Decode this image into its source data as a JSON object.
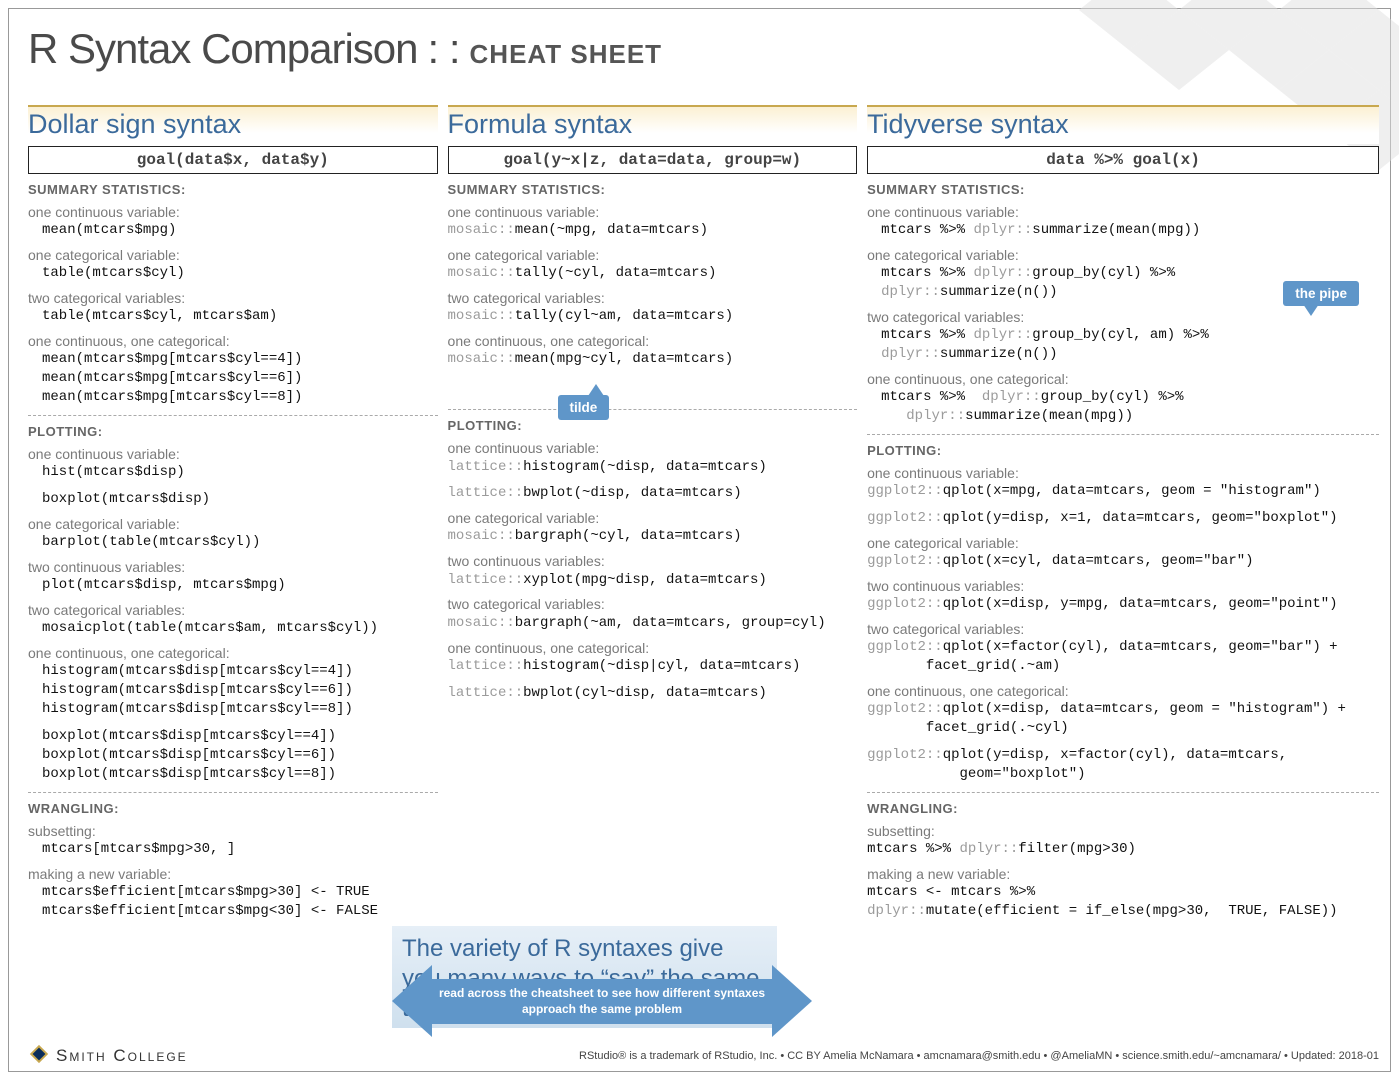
{
  "title_main": "R Syntax Comparison",
  "title_sep": ": :",
  "title_sub": "CHEAT SHEET",
  "columns": {
    "dollar": {
      "title": "Dollar sign syntax",
      "goal": "goal(data$x, data$y)",
      "summary_label": "SUMMARY STATISTICS:",
      "s1_desc": "one continuous variable:",
      "s1_code": "mean(mtcars$mpg)",
      "s2_desc": "one categorical variable:",
      "s2_code": "table(mtcars$cyl)",
      "s3_desc": "two categorical variables:",
      "s3_code": "table(mtcars$cyl, mtcars$am)",
      "s4_desc": "one continuous, one categorical:",
      "s4_code": "mean(mtcars$mpg[mtcars$cyl==4])\nmean(mtcars$mpg[mtcars$cyl==6])\nmean(mtcars$mpg[mtcars$cyl==8])",
      "plot_label": "PLOTTING:",
      "p1_desc": "one continuous variable:",
      "p1_code": "hist(mtcars$disp)",
      "p1b_code": "boxplot(mtcars$disp)",
      "p2_desc": "one categorical variable:",
      "p2_code": "barplot(table(mtcars$cyl))",
      "p3_desc": "two continuous variables:",
      "p3_code": "plot(mtcars$disp, mtcars$mpg)",
      "p4_desc": "two categorical variables:",
      "p4_code": "mosaicplot(table(mtcars$am, mtcars$cyl))",
      "p5_desc": "one continuous, one categorical:",
      "p5_code": "histogram(mtcars$disp[mtcars$cyl==4])\nhistogram(mtcars$disp[mtcars$cyl==6])\nhistogram(mtcars$disp[mtcars$cyl==8])",
      "p5b_code": "boxplot(mtcars$disp[mtcars$cyl==4])\nboxplot(mtcars$disp[mtcars$cyl==6])\nboxplot(mtcars$disp[mtcars$cyl==8])",
      "wrang_label": "WRANGLING:",
      "w1_desc": "subsetting:",
      "w1_code": "mtcars[mtcars$mpg>30, ]",
      "w2_desc": "making a new variable:",
      "w2_code": "mtcars$efficient[mtcars$mpg>30] <- TRUE\nmtcars$efficient[mtcars$mpg<30] <- FALSE"
    },
    "formula": {
      "title": "Formula syntax",
      "goal": "goal(y~x|z, data=data, group=w)",
      "summary_label": "SUMMARY STATISTICS:",
      "s1_desc": "one continuous variable:",
      "s1_pkg": "mosaic::",
      "s1_code": "mean(~mpg, data=mtcars)",
      "s2_desc": "one categorical variable:",
      "s2_pkg": "mosaic::",
      "s2_code": "tally(~cyl, data=mtcars)",
      "s3_desc": "two categorical variables:",
      "s3_pkg": "mosaic::",
      "s3_code": "tally(cyl~am, data=mtcars)",
      "s4_desc": "one continuous, one categorical:",
      "s4_pkg": "mosaic::",
      "s4_code": "mean(mpg~cyl, data=mtcars)",
      "tilde_label": "tilde",
      "plot_label": "PLOTTING:",
      "p1_desc": "one continuous variable:",
      "p1_pkg": "lattice::",
      "p1_code": "histogram(~disp, data=mtcars)",
      "p1b_pkg": "lattice::",
      "p1b_code": "bwplot(~disp, data=mtcars)",
      "p2_desc": "one categorical variable:",
      "p2_pkg": "mosaic::",
      "p2_code": "bargraph(~cyl, data=mtcars)",
      "p3_desc": "two continuous variables:",
      "p3_pkg": "lattice::",
      "p3_code": "xyplot(mpg~disp, data=mtcars)",
      "p4_desc": "two categorical variables:",
      "p4_pkg": "mosaic::",
      "p4_code": "bargraph(~am, data=mtcars, group=cyl)",
      "p5_desc": "one continuous, one categorical:",
      "p5_pkg": "lattice::",
      "p5_code": "histogram(~disp|cyl, data=mtcars)",
      "p5b_pkg": "lattice::",
      "p5b_code": "bwplot(cyl~disp, data=mtcars)"
    },
    "tidy": {
      "title": "Tidyverse syntax",
      "goal": "data %>% goal(x)",
      "summary_label": "SUMMARY STATISTICS:",
      "s1_desc": "one continuous variable:",
      "s1_code_a": "mtcars %>% ",
      "s1_pkg": "dplyr::",
      "s1_code_b": "summarize(mean(mpg))",
      "s2_desc": "one categorical variable:",
      "s2_code_a": "mtcars %>% ",
      "s2_pkg": "dplyr::",
      "s2_code_b": "group_by(cyl) %>%",
      "s2_line2_pkg": "dplyr::",
      "s2_line2_code": "summarize(n())",
      "pipe_label": "the pipe",
      "s3_desc": "two categorical variables:",
      "s3_code_a": "mtcars %>% ",
      "s3_pkg": "dplyr::",
      "s3_code_b": "group_by(cyl, am) %>%",
      "s3_line2_pkg": "dplyr::",
      "s3_line2_code": "summarize(n())",
      "s4_desc": "one continuous, one categorical:",
      "s4_code_a": "mtcars %>%  ",
      "s4_pkg": "dplyr::",
      "s4_code_b": "group_by(cyl) %>%",
      "s4_line2_pkg": "dplyr::",
      "s4_line2_code": "summarize(mean(mpg))",
      "plot_label": "PLOTTING:",
      "p1_desc": "one continuous variable:",
      "p1_pkg": "ggplot2::",
      "p1_code": "qplot(x=mpg, data=mtcars, geom = \"histogram\")",
      "p1b_pkg": "ggplot2::",
      "p1b_code": "qplot(y=disp, x=1, data=mtcars, geom=\"boxplot\")",
      "p2_desc": "one categorical variable:",
      "p2_pkg": "ggplot2::",
      "p2_code": "qplot(x=cyl, data=mtcars, geom=\"bar\")",
      "p3_desc": "two continuous variables:",
      "p3_pkg": "ggplot2::",
      "p3_code": "qplot(x=disp, y=mpg, data=mtcars, geom=\"point\")",
      "p4_desc": "two categorical variables:",
      "p4_pkg": "ggplot2::",
      "p4_code": "qplot(x=factor(cyl), data=mtcars, geom=\"bar\") +\n       facet_grid(.~am)",
      "p5_desc": "one continuous, one categorical:",
      "p5_pkg": "ggplot2::",
      "p5_code": "qplot(x=disp, data=mtcars, geom = \"histogram\") +\n       facet_grid(.~cyl)",
      "p5b_pkg": "ggplot2::",
      "p5b_code": "qplot(y=disp, x=factor(cyl), data=mtcars,\n           geom=\"boxplot\")",
      "wrang_label": "WRANGLING:",
      "w1_desc": "subsetting:",
      "w1_code_a": "mtcars %>% ",
      "w1_pkg": "dplyr::",
      "w1_code_b": "filter(mpg>30)",
      "w2_desc": "making a new variable:",
      "w2_line1": "mtcars <- mtcars %>%",
      "w2_pkg": "dplyr::",
      "w2_code": "mutate(efficient = if_else(mpg>30,  TRUE, FALSE))"
    }
  },
  "blue_box": "The variety of R syntaxes give you many ways to “say” the same thing",
  "arrow_text": "read across the cheatsheet to see how different syntaxes approach the same problem",
  "footer": {
    "logo_text": "Smith College",
    "credits": "RStudio® is a trademark of RStudio, Inc. • CC BY Amelia McNamara • amcnamara@smith.edu • @AmeliaMN • science.smith.edu/~amcnamara/ • Updated: 2018-01"
  }
}
